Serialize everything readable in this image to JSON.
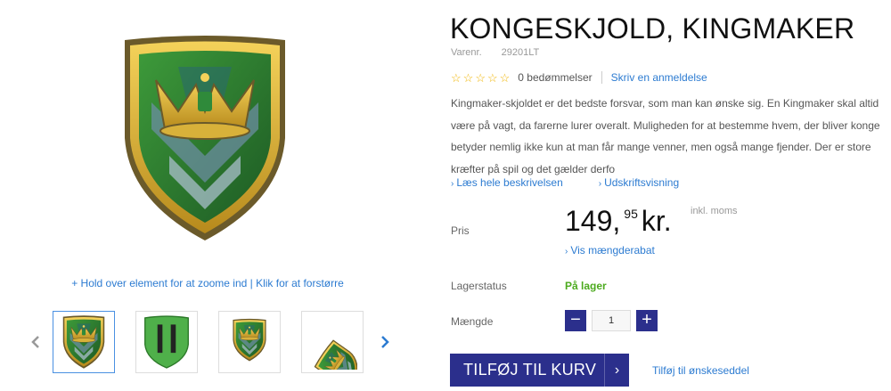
{
  "product": {
    "title": "KONGESKJOLD, KINGMAKER",
    "sku_label": "Varenr.",
    "sku": "29201LT",
    "rating_count": "0 bedømmelser",
    "review_link": "Skriv en anmeldelse",
    "description": "Kingmaker-skjoldet er det bedste forsvar, som man kan ønske sig. En Kingmaker skal altid være på vagt, da farerne lurer overalt. Muligheden for at bestemme hvem, der bliver konge betyder nemlig ikke kun at man får mange venner, men også mange fjender. Der er store kræfter på spil og det gælder derfo",
    "read_more": "Læs hele beskrivelsen",
    "print_view": "Udskriftsvisning",
    "rating_value": 0,
    "rating_max": 5
  },
  "price": {
    "label": "Pris",
    "integer": "149,",
    "decimals": "95",
    "currency": "kr.",
    "vat_note": "inkl. moms",
    "discount_link": "Vis mængderabat"
  },
  "stock": {
    "label": "Lagerstatus",
    "value": "På lager"
  },
  "quantity": {
    "label": "Mængde",
    "value": "1",
    "minus": "−",
    "plus": "+"
  },
  "actions": {
    "add_to_cart": "TILFØJ TIL KURV",
    "add_to_cart_arrow": "›",
    "wishlist": "Tilføj til ønskeseddel"
  },
  "gallery": {
    "zoom_hint": "+ Hold over element for at zoome ind | Klik for at forstørre",
    "prev_icon": "chevron-left-icon",
    "next_icon": "chevron-right-icon",
    "thumbnails": [
      "shield-front",
      "shield-back-green",
      "shield-front-small",
      "shield-angled"
    ]
  },
  "colors": {
    "accent": "#2b2f8c",
    "link": "#2c7bd1",
    "in_stock": "#4caa1e",
    "star": "#f0b400"
  }
}
